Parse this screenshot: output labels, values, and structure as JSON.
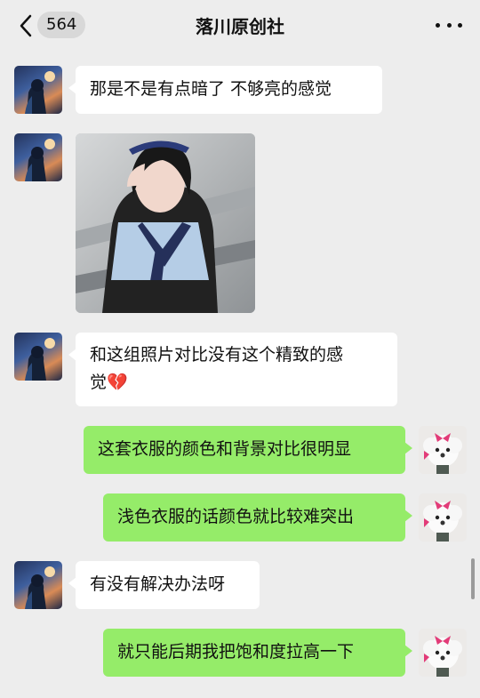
{
  "header": {
    "back_icon": "chevron-left-icon",
    "unread_count": "564",
    "title": "落川原创社",
    "more_icon": "more-dots-icon"
  },
  "messages": [
    {
      "side": "left",
      "type": "text",
      "text": "那是不是有点暗了 不够亮的感觉"
    },
    {
      "side": "left",
      "type": "image",
      "description_icon": "photo-icon"
    },
    {
      "side": "left",
      "type": "text",
      "text": "和这组照片对比没有这个精致的感",
      "text2": "觉💔"
    },
    {
      "side": "right",
      "type": "text",
      "text": "这套衣服的颜色和背景对比很明显"
    },
    {
      "side": "right",
      "type": "text",
      "text": "浅色衣服的话颜色就比较难突出"
    },
    {
      "side": "left",
      "type": "text",
      "text": "有没有解决办法呀"
    },
    {
      "side": "right",
      "type": "text",
      "text": "就只能后期我把饱和度拉高一下"
    }
  ],
  "colors": {
    "background": "#ededed",
    "bubble_left": "#ffffff",
    "bubble_right": "#95ec69"
  }
}
